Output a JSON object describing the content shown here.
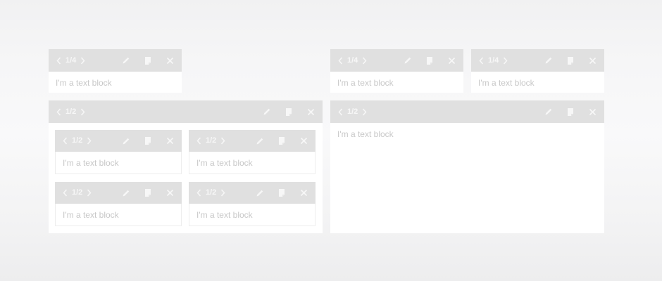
{
  "blocks": {
    "top_left": {
      "counter": "1/4",
      "text": "I'm a text block"
    },
    "top_right_a": {
      "counter": "1/4",
      "text": "I'm a text block"
    },
    "top_right_b": {
      "counter": "1/4",
      "text": "I'm a text block"
    },
    "container_left": {
      "counter": "1/2",
      "children": [
        {
          "counter": "1/2",
          "text": "I'm a text block"
        },
        {
          "counter": "1/2",
          "text": "I'm a text block"
        },
        {
          "counter": "1/2",
          "text": "I'm a text block"
        },
        {
          "counter": "1/2",
          "text": "I'm a text block"
        }
      ]
    },
    "container_right": {
      "counter": "1/2",
      "text": "I'm a text block"
    }
  },
  "icons": {
    "prev": "chevron-left-icon",
    "next": "chevron-right-icon",
    "edit": "pencil-icon",
    "copy": "document-icon",
    "close": "close-icon"
  },
  "colors": {
    "bar": "#e0e0e0",
    "icon": "#f7f7f7",
    "text": "#c8c8c8",
    "panel": "#ffffff"
  }
}
